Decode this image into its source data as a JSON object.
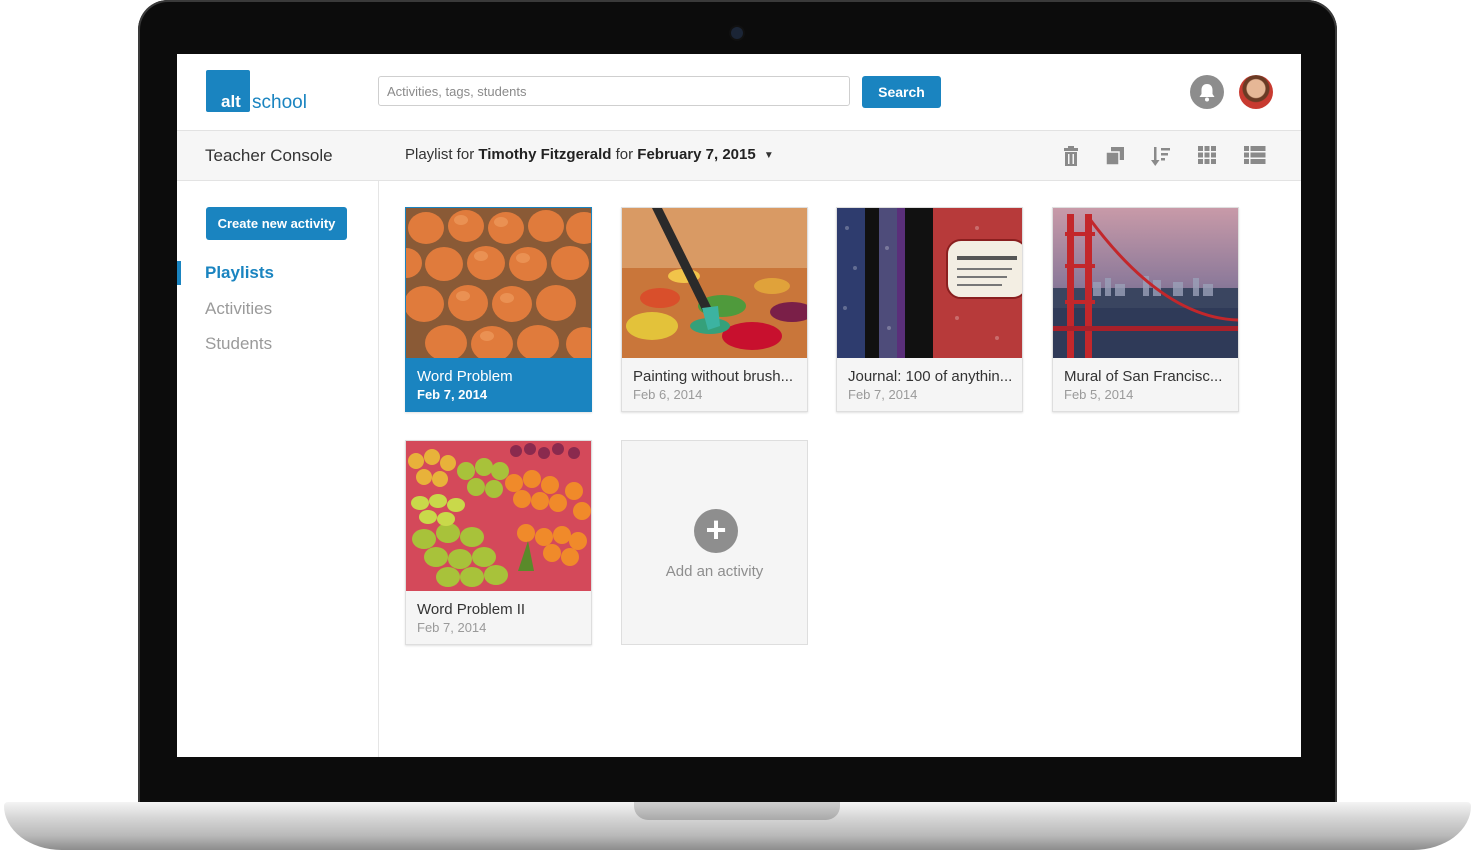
{
  "header": {
    "logo": {
      "alt": "alt",
      "school": "school"
    },
    "search": {
      "placeholder": "Activities, tags, students",
      "button_label": "Search"
    },
    "icons": {
      "notifications": "bell-icon",
      "profile": "avatar"
    }
  },
  "subheader": {
    "console_title": "Teacher Console",
    "playlist": {
      "prefix": "Playlist for",
      "student": "Timothy Fitzgerald",
      "mid": "for",
      "date": "February 7, 2015"
    },
    "tools": [
      "trash-icon",
      "duplicate-icon",
      "sort-icon",
      "grid-view-icon",
      "list-view-icon"
    ]
  },
  "sidebar": {
    "create_label": "Create new activity",
    "items": [
      {
        "label": "Playlists",
        "active": true
      },
      {
        "label": "Activities",
        "active": false
      },
      {
        "label": "Students",
        "active": false
      }
    ]
  },
  "cards": [
    {
      "title": "Word Problem",
      "date": "Feb 7, 2014",
      "selected": true
    },
    {
      "title": "Painting without brush...",
      "date": "Feb 6, 2014",
      "selected": false
    },
    {
      "title": "Journal: 100 of anythin...",
      "date": "Feb 7, 2014",
      "selected": false
    },
    {
      "title": "Mural of San Francisc...",
      "date": "Feb 5, 2014",
      "selected": false
    },
    {
      "title": "Word Problem II",
      "date": "Feb 7, 2014",
      "selected": false
    }
  ],
  "add_card": {
    "label": "Add an activity"
  },
  "colors": {
    "accent": "#1a84c0",
    "muted": "#9a9a9a"
  }
}
